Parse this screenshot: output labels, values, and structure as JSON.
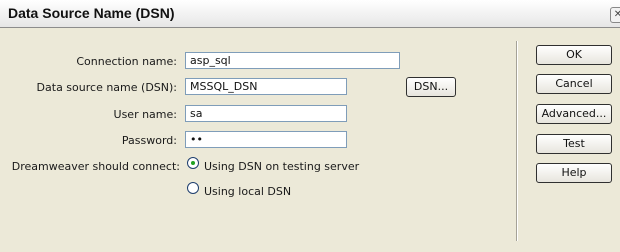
{
  "window": {
    "title": "Data Source Name (DSN)",
    "close_glyph": "✕"
  },
  "form": {
    "connection_name_label": "Connection name:",
    "connection_name_value": "asp_sql",
    "dsn_label": "Data source name (DSN):",
    "dsn_value": "MSSQL_DSN",
    "dsn_button_label": "DSN...",
    "user_name_label": "User name:",
    "user_name_value": "sa",
    "password_label": "Password:",
    "password_value": "••",
    "connect_label": "Dreamweaver should connect:",
    "radio_options": [
      {
        "label": "Using DSN on testing server",
        "selected": true
      },
      {
        "label": "Using local DSN",
        "selected": false
      }
    ]
  },
  "buttons": {
    "ok_label": "OK",
    "cancel_label": "Cancel",
    "advanced_label": "Advanced...",
    "test_label": "Test",
    "help_label": "Help"
  }
}
